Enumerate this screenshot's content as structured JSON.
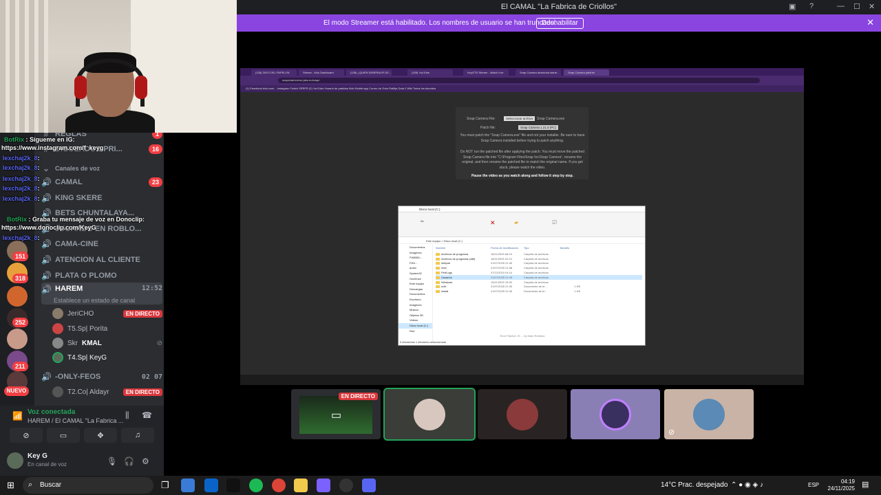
{
  "window": {
    "title": "El CAMAL \"La Fabrica de Criollos\""
  },
  "streamer_banner": {
    "text": "El modo Streamer está habilitado. Los nombres de usuario se han truncado.",
    "button": "Deshabilitar"
  },
  "server_badges": [
    "151",
    "318",
    "252",
    "211"
  ],
  "new_label": "NUEVO",
  "overlay_chat": [
    {
      "user": "BotRix",
      "text": ": Sígueme en IG:"
    },
    {
      "user": "",
      "text": "https://www.instagram.com/f_keyg"
    },
    {
      "user": "lexchaj2k_8",
      "text": ":"
    },
    {
      "user": "lexchaj2k_8",
      "text": ":"
    },
    {
      "user": "lexchaj2k_8",
      "text": ":"
    },
    {
      "user": "lexchaj2k_8",
      "text": ":"
    },
    {
      "user": "lexchaj2k_8",
      "text": ":"
    },
    {
      "user": "BotRix",
      "text": ": Graba tu mensaje de voz en Donoclip:"
    },
    {
      "user": "",
      "text": "https://www.donoclip.com/KeyG"
    },
    {
      "user": "lexchaj2k_8",
      "text": ":"
    }
  ],
  "channels": [
    {
      "label": "REGLAS",
      "badge": "1"
    },
    {
      "label": "DIGUEADOS-PRI...",
      "badge": "16"
    },
    {
      "label": "Canales de voz"
    },
    {
      "label": "CAMAL",
      "badge": "23"
    },
    {
      "label": "KING SKERE"
    },
    {
      "label": "BETS CHUNTALAYA..."
    },
    {
      "label": "JUGANDO EN ROBLO..."
    },
    {
      "label": "CAMA-CINE"
    },
    {
      "label": "ATENCION AL CLIENTE"
    },
    {
      "label": "PLATA O PLOMO"
    },
    {
      "label": "HAREM",
      "time": "12:52",
      "status": "Establece un estado de canal"
    },
    {
      "label": "-ONLY-FEOS",
      "count_a": "02",
      "count_b": "07"
    }
  ],
  "voice_users": [
    {
      "name": "JeriCHO",
      "live": "EN DIRECTO"
    },
    {
      "name": "T5.Sp| Porita"
    },
    {
      "name": "Skr",
      "tag": "KMAL"
    },
    {
      "name": "T4.Sp| KeyG"
    },
    {
      "name": "T2.Co| Aldayr",
      "live": "EN DIRECTO"
    }
  ],
  "voice_panel": {
    "title": "Voz conectada",
    "subtitle": "HAREM / El CAMAL \"La Fabrica ..."
  },
  "user_panel": {
    "name": "Key G",
    "status": "En canal de voz"
  },
  "stream": {
    "browser_tabs": [
      "(138) ZAYO DEL PAPELON",
      "Stream - Kick Dashboard",
      "(138) ¿QUIEN DEBERIA IR DE...",
      "(158) YouTube",
      "KeyGTD Stream - Watch Live",
      "Snap Camera download starte...",
      "Snap Camera patcher"
    ],
    "url": "snapchatreverse.jaku.eu/snap/",
    "bookmarks": "(1) Facebook   kick.com/...   Instagram   Twitch   SRRFR   (2) YouTube   Horario de partidas   Kick   Kicklet.app   Correo de Zoho   Rafflys   Dota 2 Wiki   Todos los favoritos",
    "patcher": {
      "file_label": "Snap Camera File:",
      "file_button": "Seleccionar archivo",
      "file_name": "Snap Camera.exe",
      "patch_label": "Patch file:",
      "patch_value": "Snap Camera 1.21.0 (PC)",
      "note1": "You must patch the \"Snap Camera.exe\" file and not your installer. Be sure to have Snap Camera installed before trying to patch anything.",
      "note2": "Do NOT run the patched file after applying the patch. You must move the patched Snap Camera file into \"C:\\Program Files\\Snap Inc\\Snap Camera\", rename the original, and then rename the patched file to match the original name. If you get stuck, please watch the video.",
      "note3": "Pause the video as you watch along and follow it step by step."
    },
    "footer": "Rom Patcher JS ... by Marc Robledo",
    "explorer": {
      "title": "Disco local (C:)",
      "address": "Este equipo > Disco local (C:)",
      "nav": [
        "Documentos",
        "Imágenes",
        "FW8551...",
        "FW1...",
        "audio",
        "System32",
        "OneDrive",
        "Este equipo",
        "Descargas",
        "Documentos",
        "Escritorio",
        "Imágenes",
        "Música",
        "Objetos 3D",
        "Videos",
        "Disco local (C:)",
        "Red"
      ],
      "columns": [
        "Nombre",
        "Fecha de modificación",
        "Tipo",
        "Tamaño"
      ],
      "rows": [
        {
          "name": "Archivos de programa",
          "date": "18/11/2025 08:19",
          "type": "Carpeta de archivos",
          "size": ""
        },
        {
          "name": "Archivos de programa (x86)",
          "date": "18/11/2025 22:10",
          "type": "Carpeta de archivos",
          "size": ""
        },
        {
          "name": "inetpub",
          "date": "21/07/2025 21:40",
          "type": "Carpeta de archivos",
          "size": ""
        },
        {
          "name": "Intel",
          "date": "21/07/2025 21:58",
          "type": "Carpeta de archivos",
          "size": ""
        },
        {
          "name": "PerfLogs",
          "date": "07/12/2019 04:14",
          "type": "Carpeta de archivos",
          "size": ""
        },
        {
          "name": "Usuarios",
          "date": "21/07/2025 21:49",
          "type": "Carpeta de archivos",
          "size": "",
          "selected": true
        },
        {
          "name": "Windows",
          "date": "15/11/2025 19:39",
          "type": "Carpeta de archivos",
          "size": ""
        },
        {
          "name": "a.lib",
          "date": "21/07/2025 21:30",
          "type": "Documento de te...",
          "size": "1 KB"
        },
        {
          "name": "install",
          "date": "21/07/2025 21:30",
          "type": "Documento de te...",
          "size": "1 KB"
        }
      ],
      "status": "9 elementos   1 elemento seleccionado"
    }
  },
  "participants": [
    {
      "live": "EN DIRECTO"
    },
    {},
    {},
    {},
    {}
  ],
  "taskbar": {
    "search": "Buscar",
    "weather": "14°C  Prac. despejado",
    "lang": "ESP",
    "time": "04:19",
    "date": "24/11/2025"
  }
}
